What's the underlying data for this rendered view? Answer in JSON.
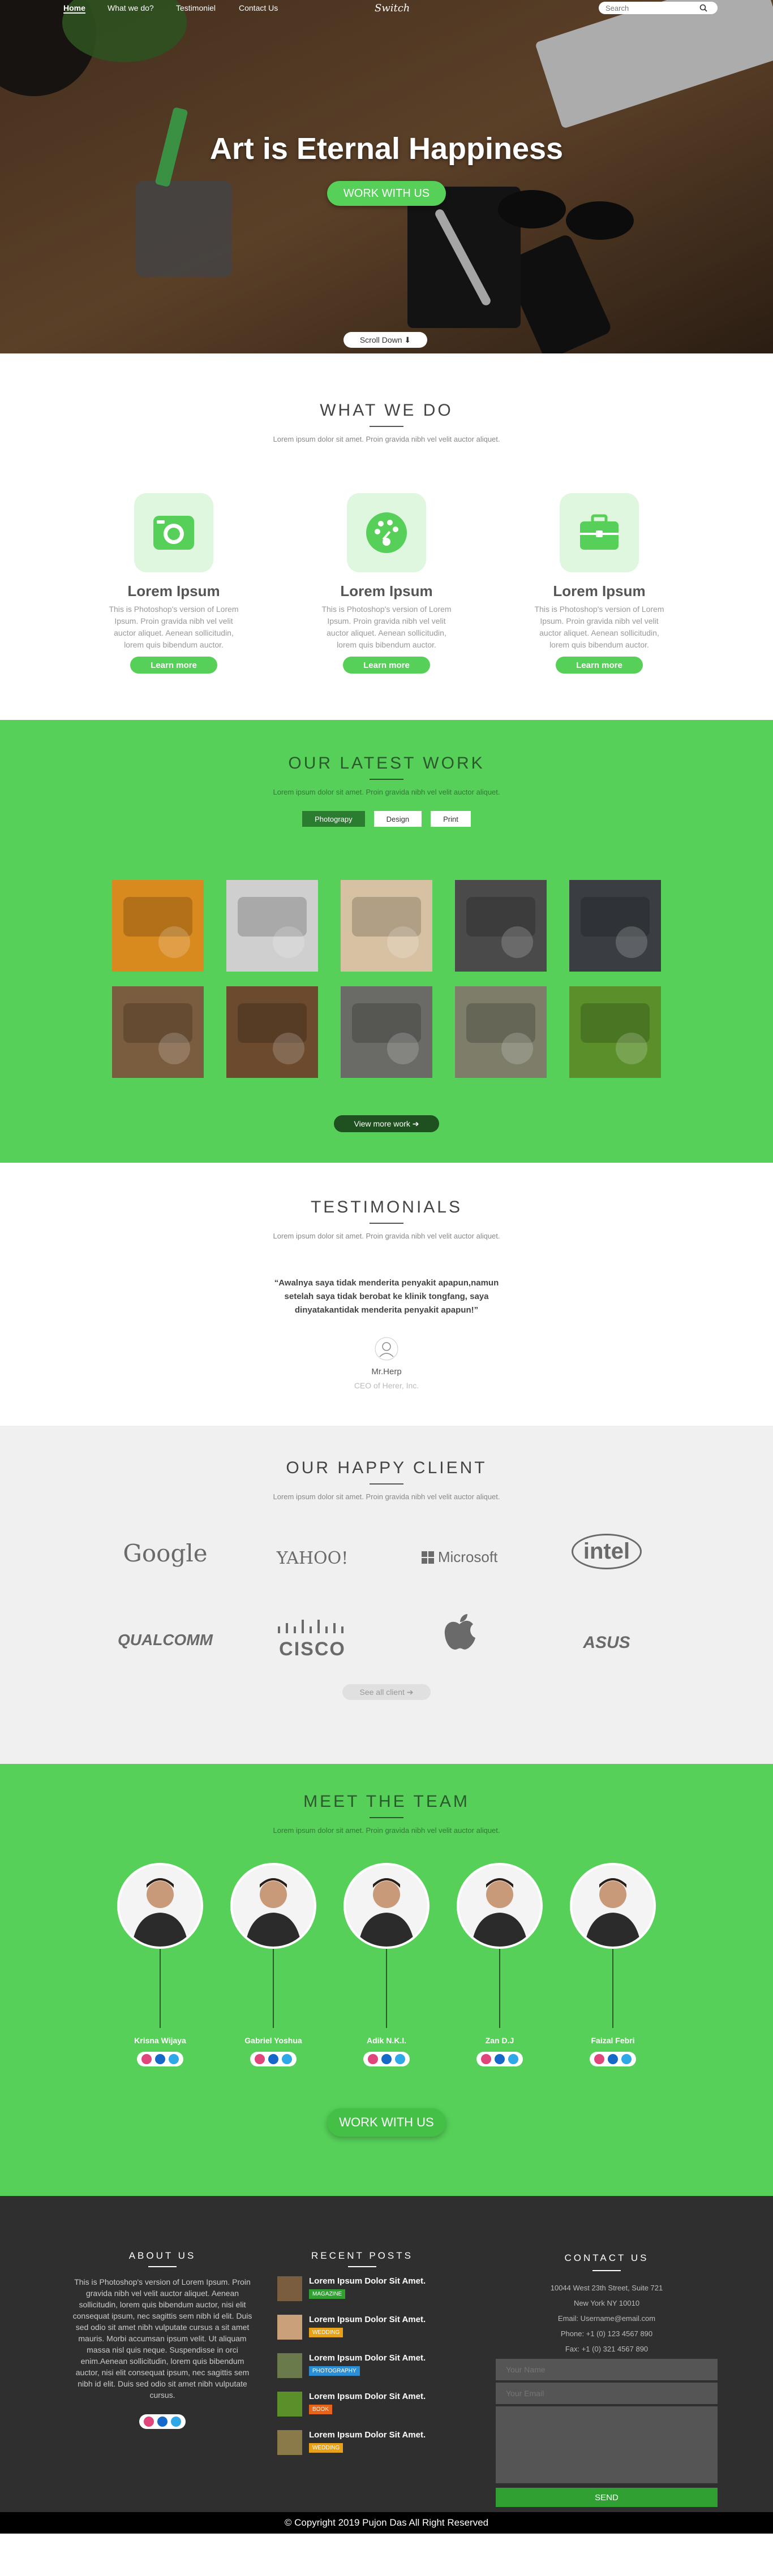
{
  "nav": {
    "items": [
      "Home",
      "What we do?",
      "Testimoniel",
      "Contact Us"
    ],
    "logo": "Switch",
    "search_placeholder": "Search"
  },
  "hero": {
    "title": "Art is Eternal Happiness",
    "cta": "WORK WITH US",
    "scroll": "Scroll Down ⬇"
  },
  "whatwedo": {
    "title": "WHAT WE DO",
    "subtitle": "Lorem ipsum dolor sit amet. Proin gravida nibh vel velit auctor aliquet.",
    "services": [
      {
        "icon": "camera-icon",
        "title": "Lorem Ipsum",
        "text": "This is Photoshop's version of Lorem Ipsum. Proin gravida nibh vel velit auctor aliquet. Aenean sollicitudin, lorem quis bibendum auctor.",
        "button": "Learn more"
      },
      {
        "icon": "palette-icon",
        "title": "Lorem Ipsum",
        "text": "This is Photoshop's version of Lorem Ipsum. Proin gravida nibh vel velit auctor aliquet. Aenean sollicitudin, lorem quis bibendum auctor.",
        "button": "Learn more"
      },
      {
        "icon": "briefcase-icon",
        "title": "Lorem Ipsum",
        "text": "This is Photoshop's version of Lorem Ipsum. Proin gravida nibh vel velit auctor aliquet. Aenean sollicitudin, lorem quis bibendum auctor.",
        "button": "Learn more"
      }
    ]
  },
  "work": {
    "title": "OUR LATEST WORK",
    "subtitle": "Lorem ipsum dolor sit amet. Proin gravida nibh vel velit auctor aliquet.",
    "filters": [
      "Photograpy",
      "Design",
      "Print"
    ],
    "more": "View more work ➔",
    "items": [
      "#d98a1e",
      "#cfcfcf",
      "#d7c1a3",
      "#4a4a4a",
      "#3a3d42",
      "#7a5c3e",
      "#6b4a2e",
      "#6a6a66",
      "#7d7d6a",
      "#5b8f2a"
    ]
  },
  "testimonials": {
    "title": "TESTIMONIALS",
    "subtitle": "Lorem ipsum dolor sit amet. Proin gravida nibh vel velit auctor aliquet.",
    "quote": "“Awalnya saya tidak menderita penyakit apapun,namun setelah saya tidak berobat ke klinik tongfang, saya dinyatakantidak menderita penyakit apapun!”",
    "name": "Mr.Herp",
    "role": "CEO of Herer, Inc."
  },
  "clients": {
    "title": "OUR HAPPY CLIENT",
    "subtitle": "Lorem ipsum dolor sit amet. Proin gravida nibh vel velit auctor aliquet.",
    "logos": [
      "Google",
      "YAHOO!",
      "Microsoft",
      "intel",
      "QUALCOMM",
      "CISCO",
      "Apple",
      "ASUS"
    ],
    "see_all": "See all client ➔"
  },
  "team": {
    "title": "MEET THE TEAM",
    "subtitle": "Lorem ipsum dolor sit amet. Proin gravida nibh vel velit auctor aliquet.",
    "members": [
      "Krisna Wijaya",
      "Gabriel Yoshua",
      "Adik N.K.I.",
      "Zan D.J",
      "Faizal Febri"
    ],
    "cta": "WORK WITH US"
  },
  "footer": {
    "about": {
      "title": "ABOUT US",
      "text": "This is Photoshop's version of Lorem Ipsum. Proin gravida nibh vel velit auctor aliquet. Aenean sollicitudin, lorem quis bibendum auctor, nisi elit consequat ipsum, nec sagittis sem nibh id elit. Duis sed odio sit amet nibh vulputate cursus a sit amet mauris. Morbi accumsan ipsum velit. Ut aliquam massa nisl quis neque. Suspendisse in orci enim.Aenean sollicitudin, lorem quis bibendum auctor, nisi elit consequat ipsum, nec sagittis sem nibh id elit. Duis sed odio sit amet nibh vulputate cursus."
    },
    "posts": {
      "title": "RECENT POSTS",
      "items": [
        {
          "title": "Lorem Ipsum Dolor Sit Amet.",
          "tag": "MAGAZINE",
          "color": "#2fa031"
        },
        {
          "title": "Lorem Ipsum Dolor Sit Amet.",
          "tag": "WEDDING",
          "color": "#e8a21a"
        },
        {
          "title": "Lorem Ipsum Dolor Sit Amet.",
          "tag": "PHOTOGRAPHY",
          "color": "#2a8fd6"
        },
        {
          "title": "Lorem Ipsum Dolor Sit Amet.",
          "tag": "BOOK",
          "color": "#e8641a"
        },
        {
          "title": "Lorem Ipsum Dolor Sit Amet.",
          "tag": "WEDDING",
          "color": "#e8a21a"
        }
      ]
    },
    "contact": {
      "title": "CONTACT US",
      "lines": [
        "10044 West 23th Street, Suite 721",
        "New York NY 10010",
        "Email: Username@email.com",
        "Phone: +1 (0) 123 4567 890",
        "Fax: +1 (0) 321 4567 890"
      ],
      "name_ph": "Your Name",
      "email_ph": "Your Email",
      "send": "SEND"
    },
    "copyright": "© Copyright 2019 Pujon Das All Right Reserved"
  }
}
